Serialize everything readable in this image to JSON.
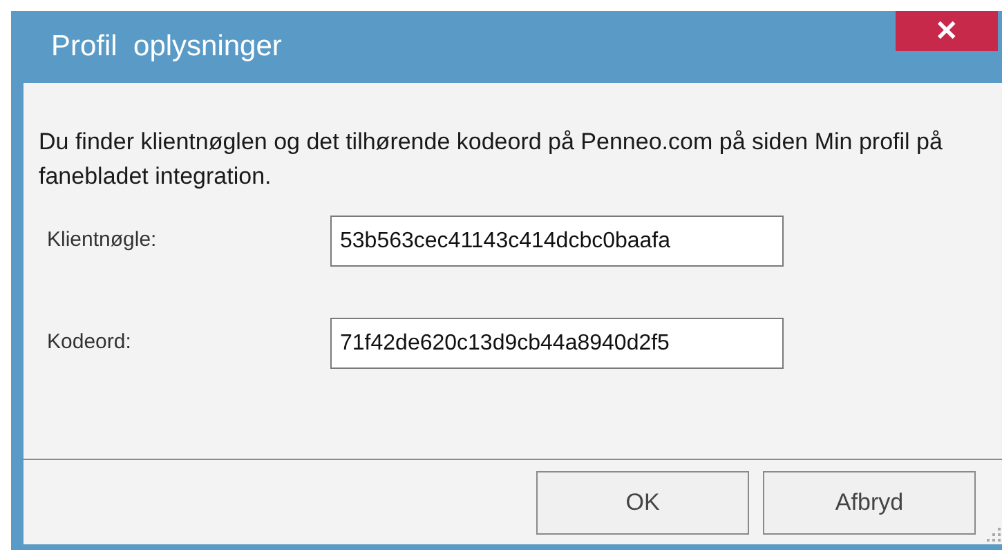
{
  "window": {
    "title": "Profil  oplysninger",
    "close": "✕"
  },
  "message": "Du finder klientnøglen og det tilhørende kodeord på Penneo.com på siden Min profil på fanebladet integration.",
  "fields": [
    {
      "label": "Klientnøgle:",
      "value": "53b563cec41143c414dcbc0baafa"
    },
    {
      "label": "Kodeord:",
      "value": "71f42de620c13d9cb44a8940d2f5"
    }
  ],
  "buttons": [
    "OK",
    "Afbryd"
  ]
}
